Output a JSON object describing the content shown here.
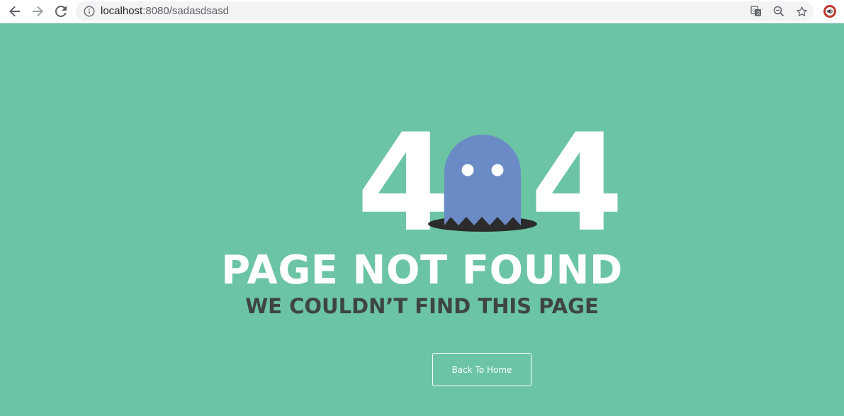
{
  "browser": {
    "url_host": "localhost",
    "url_path": ":8080/sadasdsasd",
    "icons": {
      "back": "back-arrow-icon",
      "forward": "forward-arrow-icon",
      "reload": "reload-icon",
      "info": "info-icon",
      "translate": "translate-icon",
      "zoom": "zoom-out-icon",
      "bookmark": "star-icon",
      "extension": "extension-icon"
    }
  },
  "page": {
    "digit_left": "4",
    "digit_right": "4",
    "title": "PAGE NOT FOUND",
    "subtitle": "WE COULDN’T FIND THIS PAGE",
    "button_label": "Back To Home"
  },
  "colors": {
    "background": "#6bc4a3",
    "ghost": "#6a8bc5",
    "hole": "#2b2b2b",
    "subtitle": "#3e4444"
  }
}
